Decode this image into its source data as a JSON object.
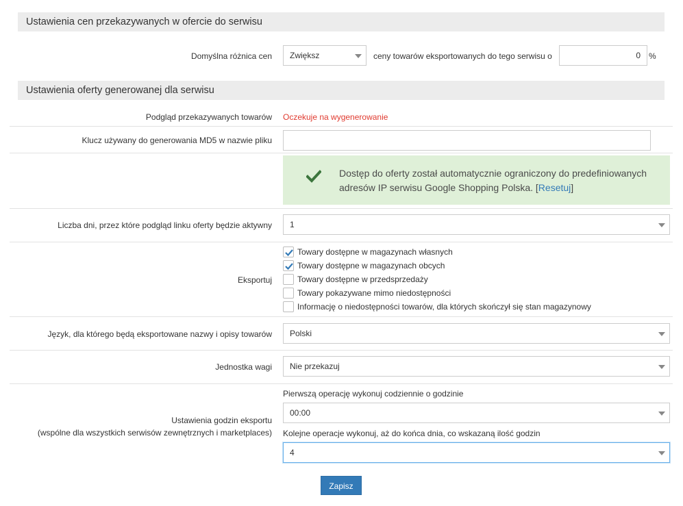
{
  "section_prices": {
    "title": "Ustawienia cen przekazywanych w ofercie do serwisu",
    "price_diff_label": "Domyślna różnica cen",
    "price_diff_select": "Zwiększ",
    "price_diff_text": "ceny towarów eksportowanych do tego serwisu o",
    "price_diff_value": "0",
    "price_diff_unit": "%"
  },
  "section_offer": {
    "title": "Ustawienia oferty generowanej dla serwisu",
    "preview_label": "Podgląd przekazywanych towarów",
    "preview_status": "Oczekuje na wygenerowanie",
    "md5_label": "Klucz używany do generowania MD5 w nazwie pliku",
    "md5_value": "",
    "alert_text": "Dostęp do oferty został automatycznie ograniczony do predefiniowanych adresów IP serwisu Google Shopping Polska.",
    "alert_reset_open": "[",
    "alert_reset": "Resetuj",
    "alert_reset_close": "]",
    "days_label": "Liczba dni, przez które podgląd linku oferty będzie aktywny",
    "days_value": "1",
    "export_label": "Eksportuj",
    "export_options": [
      {
        "label": "Towary dostępne w magazynach własnych",
        "checked": true
      },
      {
        "label": "Towary dostępne w magazynach obcych",
        "checked": true
      },
      {
        "label": "Towary dostępne w przedsprzedaży",
        "checked": false
      },
      {
        "label": "Towary pokazywane mimo niedostępności",
        "checked": false
      },
      {
        "label": "Informację o niedostępności towarów, dla których skończył się stan magazynowy",
        "checked": false
      }
    ],
    "language_label": "Język, dla którego będą eksportowane nazwy i opisy towarów",
    "language_value": "Polski",
    "weight_label": "Jednostka wagi",
    "weight_value": "Nie przekazuj",
    "hours_label_line1": "Ustawienia godzin eksportu",
    "hours_label_line2": "(wspólne dla wszystkich serwisów zewnętrznych i marketplaces)",
    "first_op_label": "Pierwszą operację wykonuj codziennie o godzinie",
    "first_op_value": "00:00",
    "next_op_label": "Kolejne operacje wykonuj, aż do końca dnia, co wskazaną ilość godzin",
    "next_op_value": "4"
  },
  "save_button": "Zapisz",
  "colors": {
    "accent": "#337ab7",
    "status_red": "#e03a2f",
    "alert_bg": "#dff0d8",
    "check_green": "#3c763d"
  },
  "icons": {
    "alert": "check-icon",
    "checkbox_mark": "checkmark-icon",
    "select_caret": "caret-down-icon"
  }
}
